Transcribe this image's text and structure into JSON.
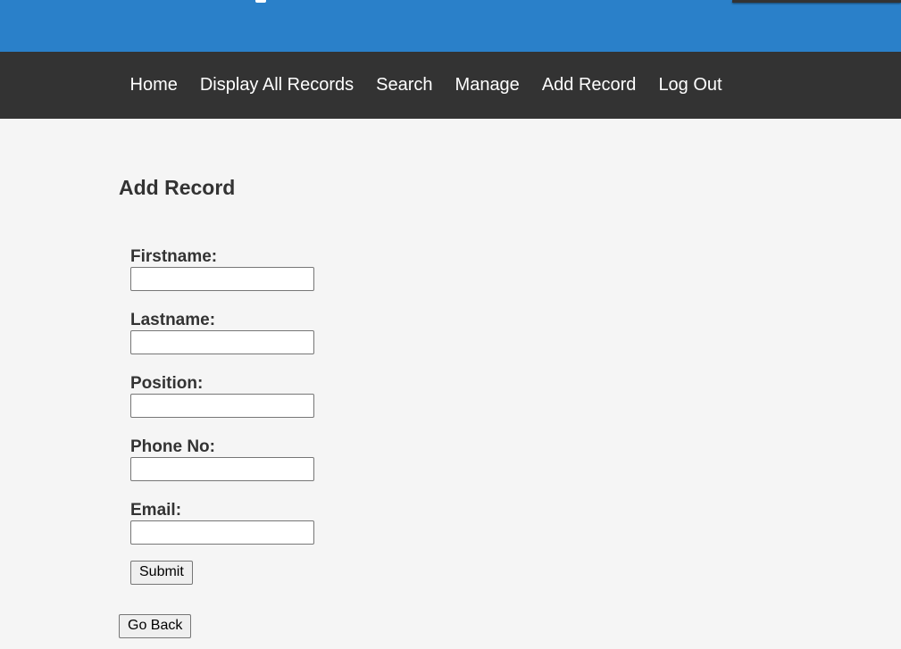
{
  "nav": {
    "items": [
      {
        "label": "Home"
      },
      {
        "label": "Display All Records"
      },
      {
        "label": "Search"
      },
      {
        "label": "Manage"
      },
      {
        "label": "Add Record"
      },
      {
        "label": "Log Out"
      }
    ]
  },
  "page": {
    "title": "Add Record"
  },
  "form": {
    "fields": [
      {
        "label": "Firstname:",
        "value": ""
      },
      {
        "label": "Lastname:",
        "value": ""
      },
      {
        "label": "Position:",
        "value": ""
      },
      {
        "label": "Phone No:",
        "value": ""
      },
      {
        "label": "Email:",
        "value": ""
      }
    ],
    "submit_label": "Submit"
  },
  "back_label": "Go Back",
  "colors": {
    "header_blue": "#2a80c9",
    "navbar_dark": "#333333",
    "page_background": "#f5f5f5"
  }
}
